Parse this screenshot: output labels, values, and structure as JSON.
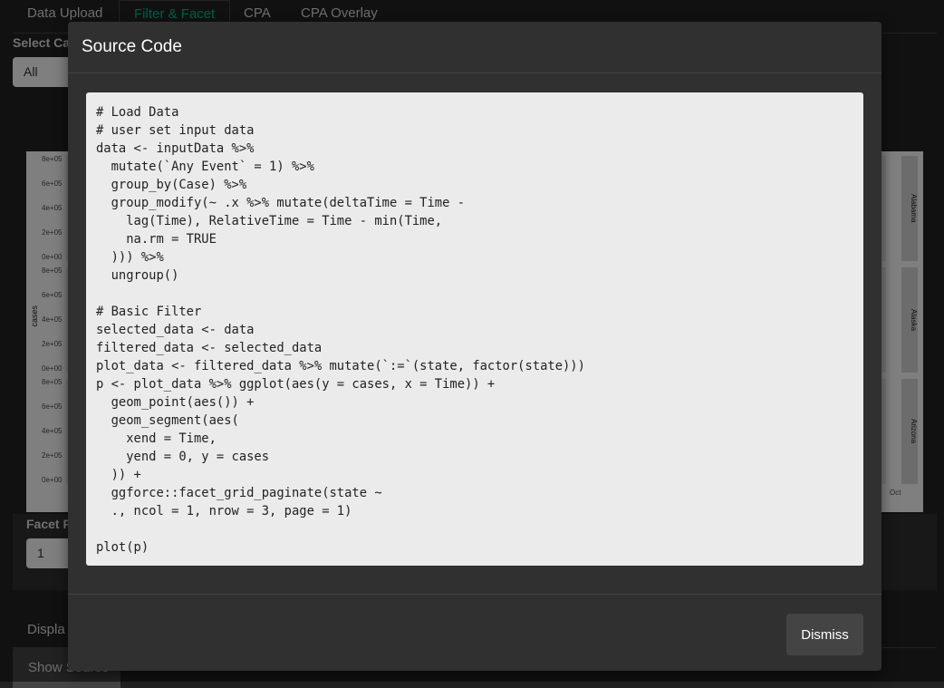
{
  "tabs": [
    {
      "label": "Data Upload"
    },
    {
      "label": "Filter & Facet"
    },
    {
      "label": "CPA"
    },
    {
      "label": "CPA Overlay"
    }
  ],
  "select_case_label": "Select Ca",
  "select_case_value": "All",
  "plot": {
    "ylabel": "cases",
    "yticks": [
      "8e+05",
      "6e+05",
      "4e+05",
      "2e+05",
      "0e+00"
    ],
    "strips": [
      "Alabama",
      "Alaska",
      "Arizona"
    ],
    "xtick_oct": "Oct"
  },
  "facet_page_label": "Facet P",
  "facet_page_value": "1",
  "display_label": "Displa",
  "show_source_label": "Show Source",
  "modal": {
    "title": "Source Code",
    "dismiss_label": "Dismiss",
    "code_lines": [
      "# Load Data",
      "# user set input data",
      "data <- inputData %>%",
      "  mutate(`Any Event` = 1) %>%",
      "  group_by(Case) %>%",
      "  group_modify(~ .x %>% mutate(deltaTime = Time -",
      "    lag(Time), RelativeTime = Time - min(Time,",
      "    na.rm = TRUE",
      "  ))) %>%",
      "  ungroup()",
      "",
      "# Basic Filter",
      "selected_data <- data",
      "filtered_data <- selected_data",
      "plot_data <- filtered_data %>% mutate(`:=`(state, factor(state)))",
      "p <- plot_data %>% ggplot(aes(y = cases, x = Time)) +",
      "  geom_point(aes()) +",
      "  geom_segment(aes(",
      "    xend = Time,",
      "    yend = 0, y = cases",
      "  )) +",
      "  ggforce::facet_grid_paginate(state ~",
      "  ., ncol = 1, nrow = 3, page = 1)",
      "",
      "plot(p)"
    ]
  }
}
